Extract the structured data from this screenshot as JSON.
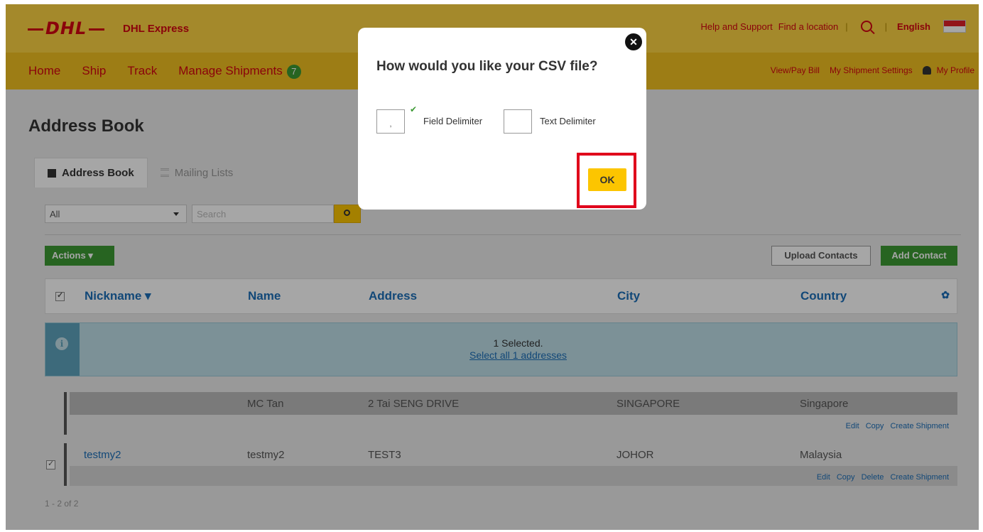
{
  "header": {
    "brand": "DHL",
    "express": "DHL Express",
    "links": [
      "Help and Support",
      "Find a location"
    ],
    "language": "English"
  },
  "nav": {
    "items": [
      "Home",
      "Ship",
      "Track",
      "Manage Shipments"
    ],
    "badge": "7",
    "right": [
      "View/Pay Bill",
      "My Shipment Settings",
      "My Profile"
    ]
  },
  "page": {
    "title": "Address Book",
    "tabs": [
      "Address Book",
      "Mailing Lists"
    ],
    "filter_value": "All",
    "search_placeholder": "Search",
    "actions_label": "Actions",
    "upload_label": "Upload Contacts",
    "add_label": "Add Contact"
  },
  "table": {
    "headers": [
      "Nickname",
      "Name",
      "Address",
      "City",
      "Country"
    ],
    "info_text": "1 Selected.",
    "info_link": "Select all 1 addresses",
    "rows": [
      {
        "nickname": "",
        "name": "MC Tan",
        "address": "2 Tai SENG DRIVE",
        "city": "SINGAPORE",
        "country": "Singapore",
        "actions": [
          "Edit",
          "Copy",
          "Create Shipment"
        ]
      },
      {
        "nickname": "testmy2",
        "name": "testmy2",
        "address": "TEST3",
        "city": "JOHOR",
        "country": "Malaysia",
        "actions": [
          "Edit",
          "Copy",
          "Delete",
          "Create Shipment"
        ]
      }
    ],
    "pager": "1 - 2 of 2"
  },
  "modal": {
    "title": "How would you like your CSV file?",
    "field_delimiter_value": ",",
    "field_delimiter_label": "Field Delimiter",
    "text_delimiter_value": "",
    "text_delimiter_label": "Text Delimiter",
    "ok_label": "OK",
    "close_glyph": "✕"
  }
}
